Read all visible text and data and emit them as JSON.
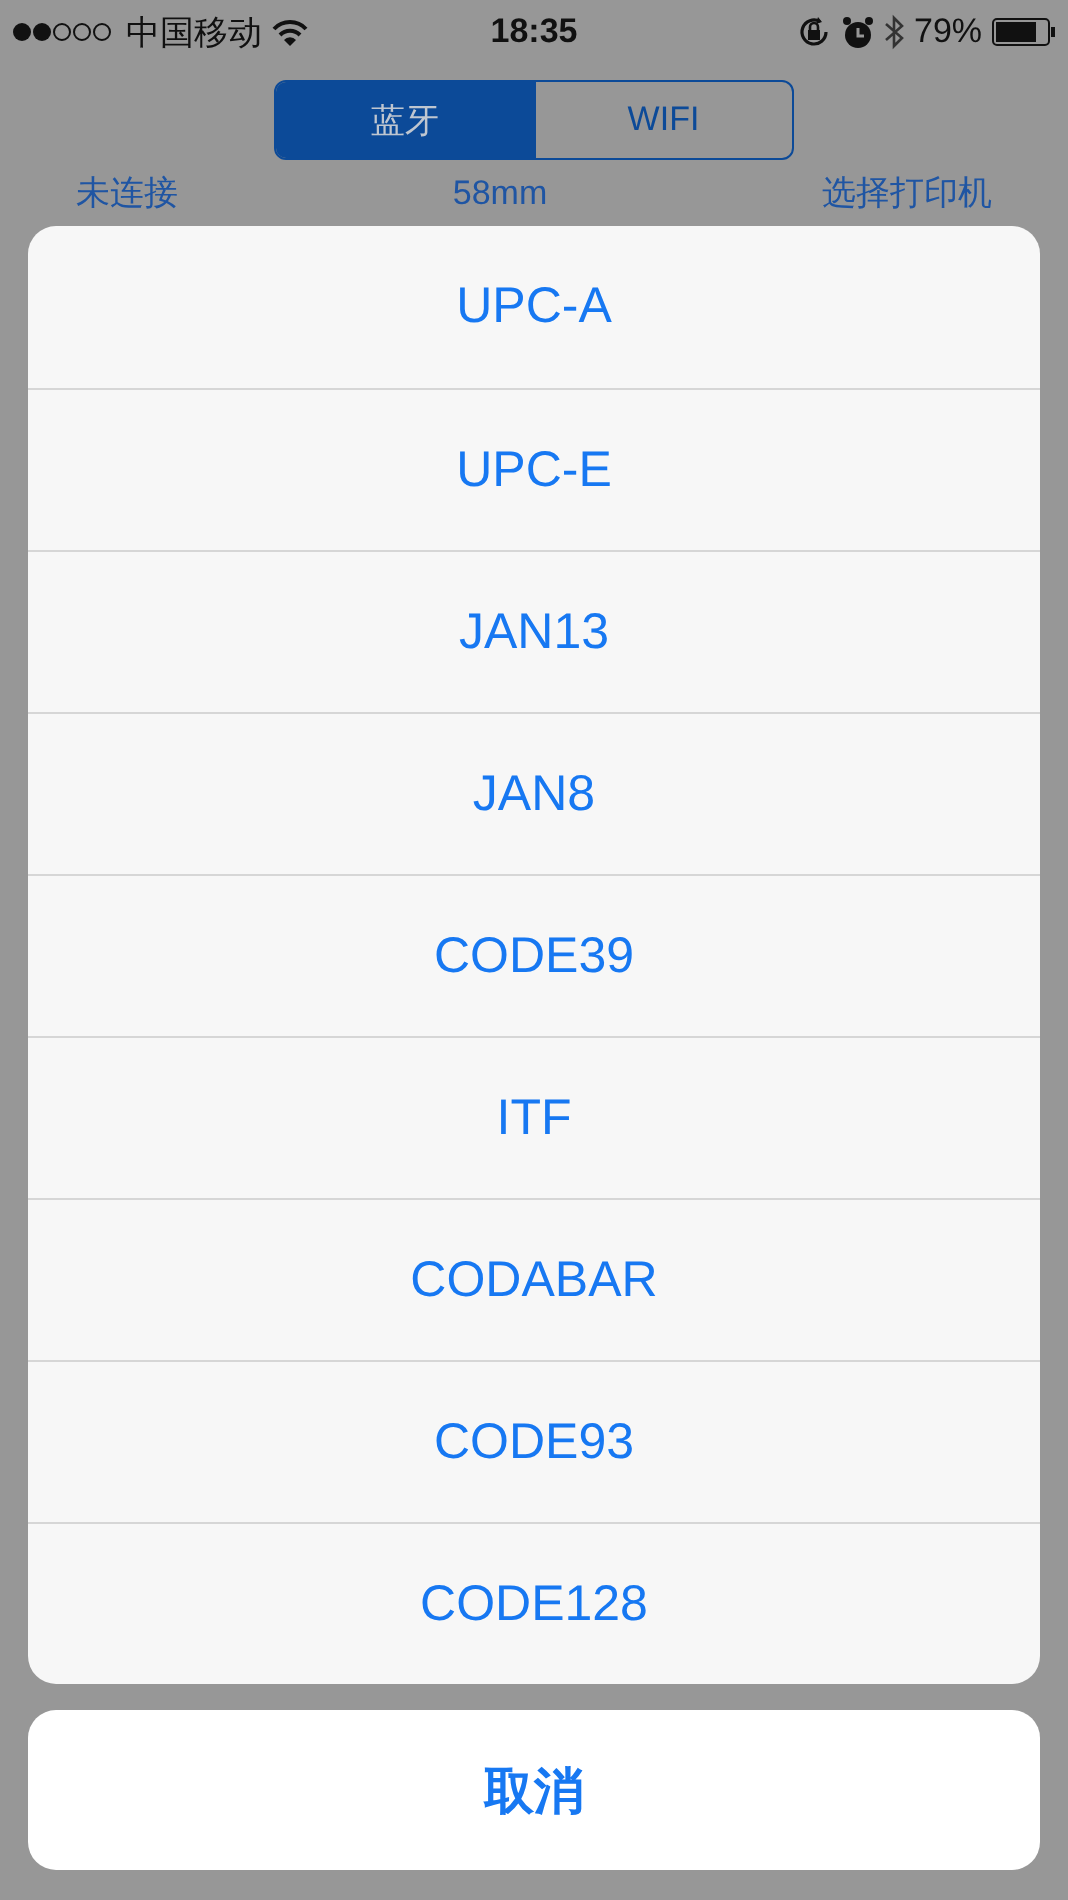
{
  "status_bar": {
    "carrier": "中国移动",
    "time": "18:35",
    "battery": "79%"
  },
  "segments": [
    {
      "label": "蓝牙",
      "selected": true
    },
    {
      "label": "WIFI",
      "selected": false
    }
  ],
  "printer_row": {
    "status": "未连接",
    "paper": "58mm",
    "select": "选择打印机"
  },
  "action_sheet": {
    "options": [
      "UPC-A",
      "UPC-E",
      "JAN13",
      "JAN8",
      "CODE39",
      "ITF",
      "CODABAR",
      "CODE93",
      "CODE128"
    ],
    "cancel": "取消"
  }
}
